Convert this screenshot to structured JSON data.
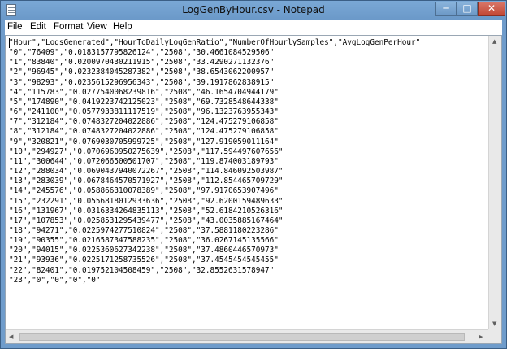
{
  "window": {
    "title": "LogGenByHour.csv - Notepad",
    "controls": {
      "minimize": "─",
      "maximize": "□",
      "close": "✕"
    }
  },
  "menu": {
    "file": "File",
    "edit": "Edit",
    "format": "Format",
    "view": "View",
    "help": "Help"
  },
  "editor": {
    "lines": [
      "\"Hour\",\"LogsGenerated\",\"HourToDailyLogGenRatio\",\"NumberOfHourlySamples\",\"AvgLogGenPerHour\"",
      "\"0\",\"76409\",\"0.0183157795826124\",\"2508\",\"30.4661084529506\"",
      "\"1\",\"83840\",\"0.0200970430211915\",\"2508\",\"33.4290271132376\"",
      "\"2\",\"96945\",\"0.0232384045287382\",\"2508\",\"38.6543062200957\"",
      "\"3\",\"98293\",\"0.0235615296956343\",\"2508\",\"39.1917862838915\"",
      "\"4\",\"115783\",\"0.0277540068239816\",\"2508\",\"46.1654704944179\"",
      "\"5\",\"174890\",\"0.0419223742125023\",\"2508\",\"69.7328548644338\"",
      "\"6\",\"241100\",\"0.0577933811117519\",\"2508\",\"96.1323763955343\"",
      "\"7\",\"312184\",\"0.0748327204022886\",\"2508\",\"124.475279106858\"",
      "\"8\",\"312184\",\"0.0748327204022886\",\"2508\",\"124.475279106858\"",
      "\"9\",\"320821\",\"0.0769030705999725\",\"2508\",\"127.919059011164\"",
      "\"10\",\"294927\",\"0.0706960950275639\",\"2508\",\"117.594497607656\"",
      "\"11\",\"300644\",\"0.072066500501707\",\"2508\",\"119.874003189793\"",
      "\"12\",\"288034\",\"0.0690437940072267\",\"2508\",\"114.846092503987\"",
      "\"13\",\"283039\",\"0.0678464570571927\",\"2508\",\"112.854465709729\"",
      "\"14\",\"245576\",\"0.058866310078389\",\"2508\",\"97.9170653907496\"",
      "\"15\",\"232291\",\"0.0556818012933636\",\"2508\",\"92.6200159489633\"",
      "\"16\",\"131967\",\"0.0316334264835113\",\"2508\",\"52.6184210526316\"",
      "\"17\",\"107853\",\"0.0258531295439477\",\"2508\",\"43.0035885167464\"",
      "\"18\",\"94271\",\"0.0225974277510824\",\"2508\",\"37.5881180223286\"",
      "\"19\",\"90355\",\"0.0216587347588235\",\"2508\",\"36.0267145135566\"",
      "\"20\",\"94015\",\"0.0225360627342238\",\"2508\",\"37.4860446570973\"",
      "\"21\",\"93936\",\"0.0225171258735526\",\"2508\",\"37.4545454545455\"",
      "\"22\",\"82401\",\"0.019752104508459\",\"2508\",\"32.8552631578947\"",
      "\"23\",\"0\",\"0\",\"0\",\"0\""
    ]
  }
}
